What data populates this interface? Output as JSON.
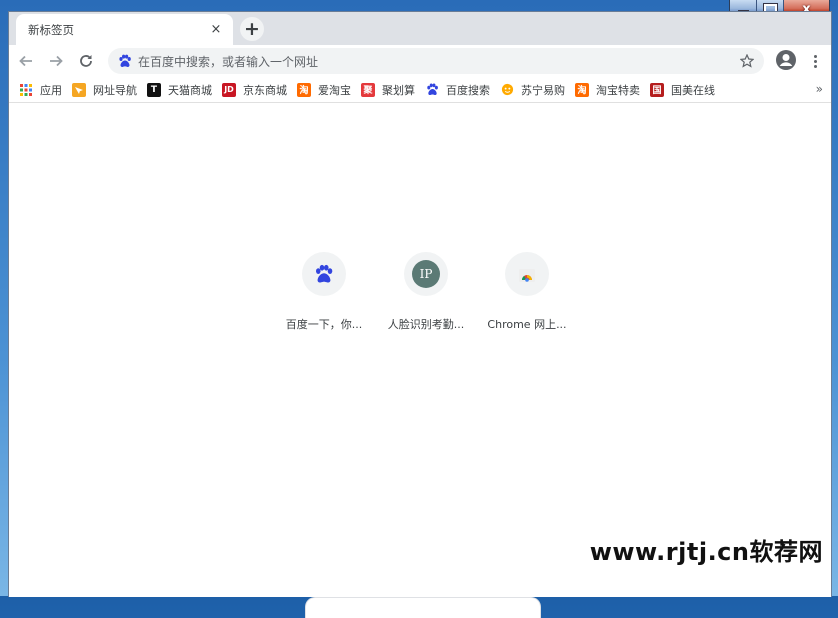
{
  "window": {
    "minimize": "",
    "maximize": "",
    "close": "x"
  },
  "tab": {
    "title": "新标签页",
    "close": "×"
  },
  "new_tab": "+",
  "omnibox": {
    "placeholder": "在百度中搜索，或者输入一个网址"
  },
  "bookmarks": [
    {
      "label": "应用",
      "icon": "apps-grid-icon",
      "color": "#4285f4"
    },
    {
      "label": "网址导航",
      "icon": "nav-arrow-icon",
      "color": "#f5a623"
    },
    {
      "label": "天猫商城",
      "icon": "tmall-icon",
      "color": "#d10000",
      "glyph": "T"
    },
    {
      "label": "京东商城",
      "icon": "jd-icon",
      "color": "#c81623",
      "glyph": "JD"
    },
    {
      "label": "爱淘宝",
      "icon": "taobao-icon",
      "color": "#ff6a00",
      "glyph": "淘"
    },
    {
      "label": "聚划算",
      "icon": "juhuasuan-icon",
      "color": "#e4393c",
      "glyph": "聚"
    },
    {
      "label": "百度搜索",
      "icon": "baidu-paw-icon",
      "color": "#3245df"
    },
    {
      "label": "苏宁易购",
      "icon": "suning-icon",
      "color": "#ffaa00"
    },
    {
      "label": "淘宝特卖",
      "icon": "taobao-sale-icon",
      "color": "#ff6a00",
      "glyph": "淘"
    },
    {
      "label": "国美在线",
      "icon": "gome-icon",
      "color": "#b51d1d",
      "glyph": "国"
    }
  ],
  "bookmarks_more": "»",
  "tiles": [
    {
      "title": "百度一下，你...",
      "icon": "baidu-paw-icon"
    },
    {
      "title": "人脸识别考勤...",
      "icon": "ip-icon",
      "glyph": "IP"
    },
    {
      "title": "Chrome 网上...",
      "icon": "chrome-webstore-icon"
    }
  ],
  "watermark": "www.rjtj.cn软荐网",
  "colors": {
    "accent": "#1a73e8",
    "baidu": "#3245df"
  }
}
